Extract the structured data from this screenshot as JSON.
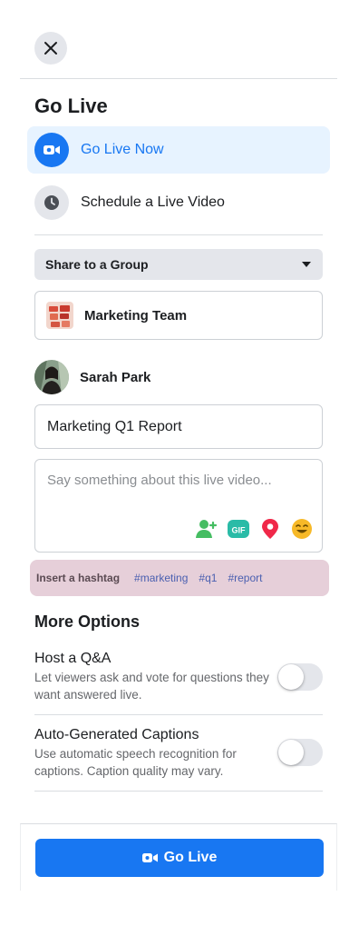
{
  "header": {
    "close_icon": "close-icon"
  },
  "title": "Go Live",
  "options": {
    "go_live_now": "Go Live Now",
    "schedule": "Schedule a Live Video"
  },
  "share": {
    "selected": "Share to a Group",
    "group_name": "Marketing Team"
  },
  "user": {
    "name": "Sarah Park"
  },
  "form": {
    "title_value": "Marketing Q1 Report",
    "description_placeholder": "Say something about this live video...",
    "tools": [
      "tag-people-icon",
      "gif-icon",
      "location-pin-icon",
      "feeling-emoji-icon"
    ]
  },
  "hashtags": {
    "label": "Insert a hashtag",
    "tags": [
      "#marketing",
      "#q1",
      "#report"
    ]
  },
  "more_options": {
    "title": "More Options",
    "qa": {
      "title": "Host a Q&A",
      "description": "Let viewers ask and vote for questions they want answered live.",
      "enabled": false
    },
    "captions": {
      "title": "Auto-Generated Captions",
      "description": "Use automatic speech recognition for captions. Caption quality may vary.",
      "enabled": false
    }
  },
  "footer": {
    "go_live_label": "Go Live"
  },
  "colors": {
    "primary": "#1877f2",
    "primary_light": "#e7f3ff",
    "hashtag_bg": "#e6cfd9",
    "toggle_off": "#e4e6eb"
  }
}
